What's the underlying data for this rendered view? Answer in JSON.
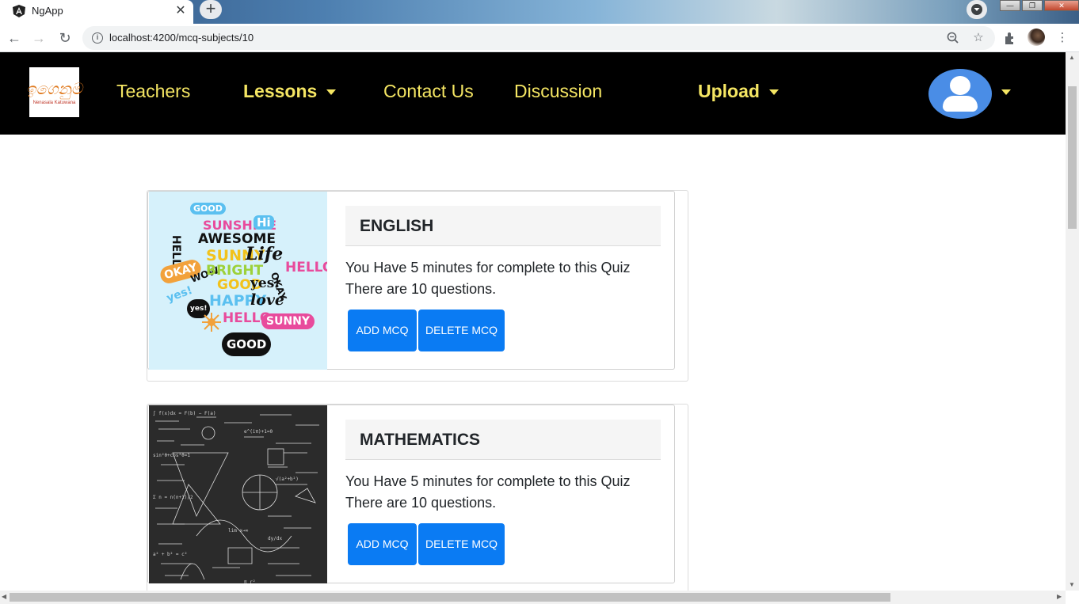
{
  "browser": {
    "tab_title": "NgApp",
    "tab_close": "✕",
    "new_tab": "+",
    "url": "localhost:4200/mcq-subjects/10",
    "window_controls": [
      "—",
      "❐",
      "✕"
    ]
  },
  "navbar": {
    "logo_script": "ඉගෙනුම",
    "logo_text": "Nenasala Katuwana",
    "links": [
      {
        "label": "Teachers"
      },
      {
        "label": "Lessons"
      },
      {
        "label": "Contact Us"
      },
      {
        "label": "Discussion"
      },
      {
        "label": "Upload"
      }
    ],
    "accent_color": "#f5e663"
  },
  "subjects": [
    {
      "title": "ENGLISH",
      "line1": "You Have 5 minutes for complete to this Quiz",
      "line2": "There are 10 questions.",
      "add_label": "ADD MCQ",
      "delete_label": "DELETE MCQ"
    },
    {
      "title": "MATHEMATICS",
      "line1": "You Have 5 minutes for complete to this Quiz",
      "line2": "There are 10 questions.",
      "add_label": "ADD MCQ",
      "delete_label": "DELETE MCQ"
    }
  ],
  "english_words": [
    "GOOD",
    "SUNSHINE",
    "Hi",
    "AWESOME",
    "HELLO",
    "SUNNY",
    "Life",
    "OKAY",
    "WOW",
    "BRIGHT",
    "HELLO",
    "GOOD",
    "yes!",
    "OKAY",
    "yes!",
    "HAPPY",
    "love",
    "yes!",
    "HELLO",
    "SUNNY",
    "GOOD"
  ],
  "colors": {
    "button": "#0a7bf3",
    "navbar_bg": "#000000",
    "avatar": "#4a8de6"
  }
}
